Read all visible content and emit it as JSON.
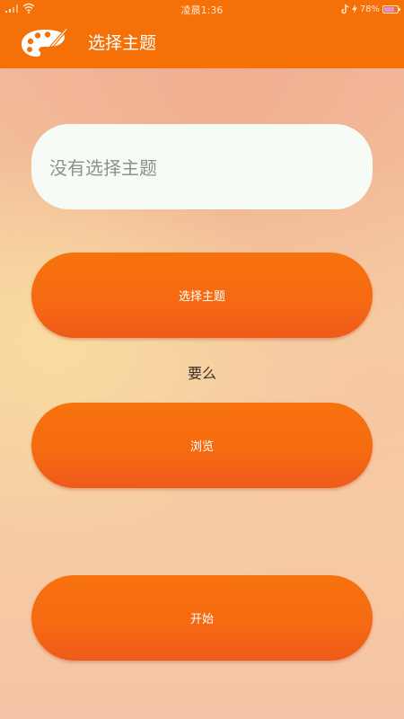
{
  "status_bar": {
    "time": "凌晨1:36",
    "battery_percent": "78%",
    "battery_level": 0.78,
    "icons": [
      "signal-icon",
      "wifi-icon",
      "tiktok-icon",
      "charging-icon",
      "battery-icon"
    ]
  },
  "app_bar": {
    "icon": "palette-icon",
    "title": "选择主题"
  },
  "main": {
    "theme_display_text": "没有选择主题",
    "select_theme_label": "选择主题",
    "or_text": "要么",
    "browse_label": "浏览",
    "start_label": "开始"
  },
  "colors": {
    "app_bar": "#f57006",
    "button": "#f66a12",
    "theme_box": "#f7fbf5"
  }
}
